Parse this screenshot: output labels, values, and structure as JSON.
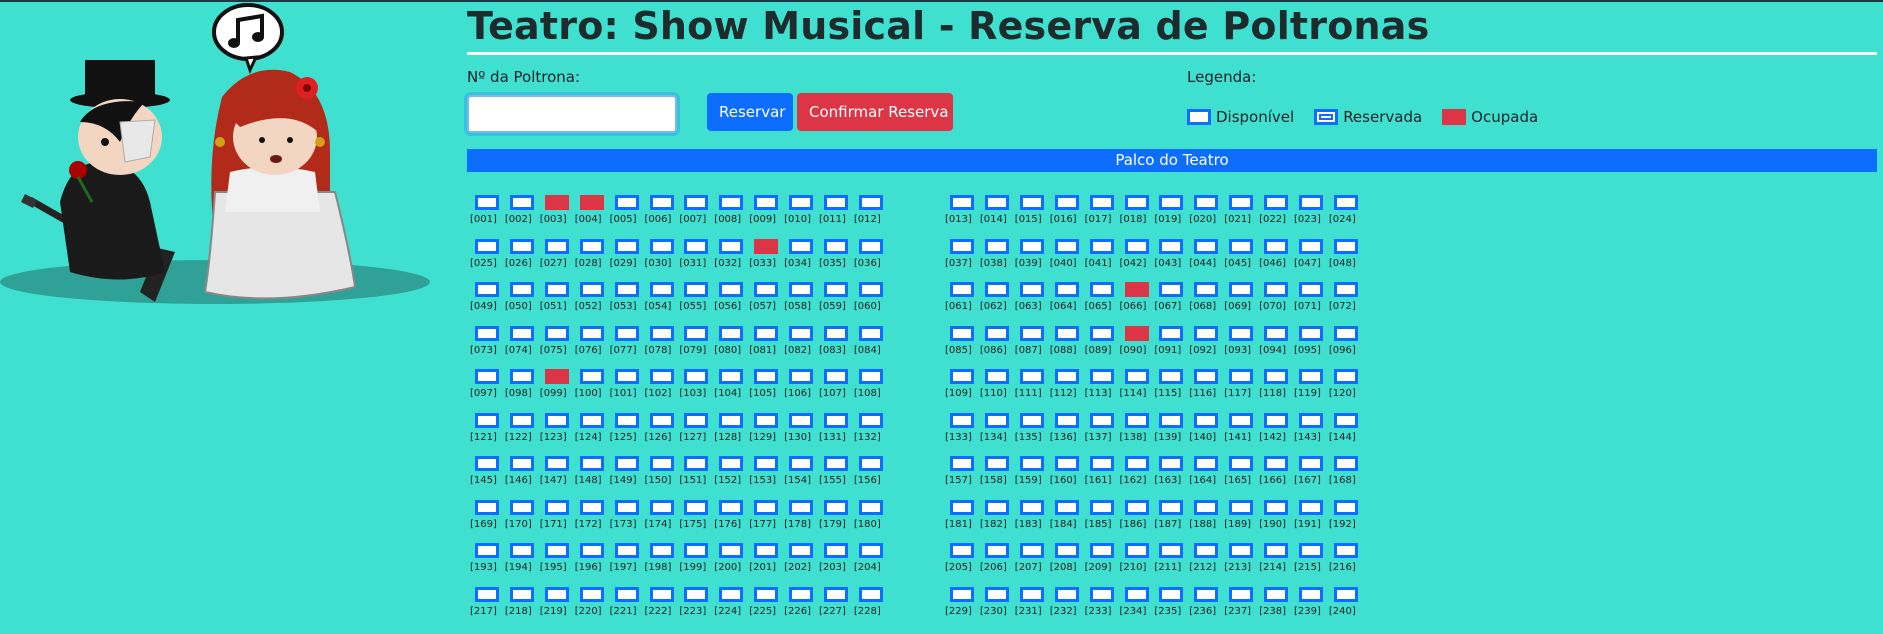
{
  "header": {
    "title": "Teatro: Show Musical - Reserva de Poltronas"
  },
  "form": {
    "seat_label": "Nº da Poltrona:",
    "seat_input_value": "",
    "reserve_button": "Reservar",
    "confirm_button": "Confirmar Reserva"
  },
  "legend": {
    "title": "Legenda:",
    "items": [
      {
        "label": "Disponível",
        "state": "disponivel"
      },
      {
        "label": "Reservada",
        "state": "reservada"
      },
      {
        "label": "Ocupada",
        "state": "ocupada"
      }
    ]
  },
  "stage": {
    "label": "Palco do Teatro"
  },
  "seats": {
    "total": 240,
    "rows": 10,
    "per_row": 24,
    "occupied": [
      3,
      4,
      33,
      66,
      90,
      99
    ],
    "reserved": []
  },
  "colors": {
    "background": "#40e0d0",
    "primary": "#0d6efd",
    "danger": "#dc3545"
  },
  "illustration": {
    "icons": [
      "music-note-icon",
      "phantom-character-icon",
      "singer-girl-icon",
      "guitar-icon",
      "rose-icon"
    ]
  }
}
